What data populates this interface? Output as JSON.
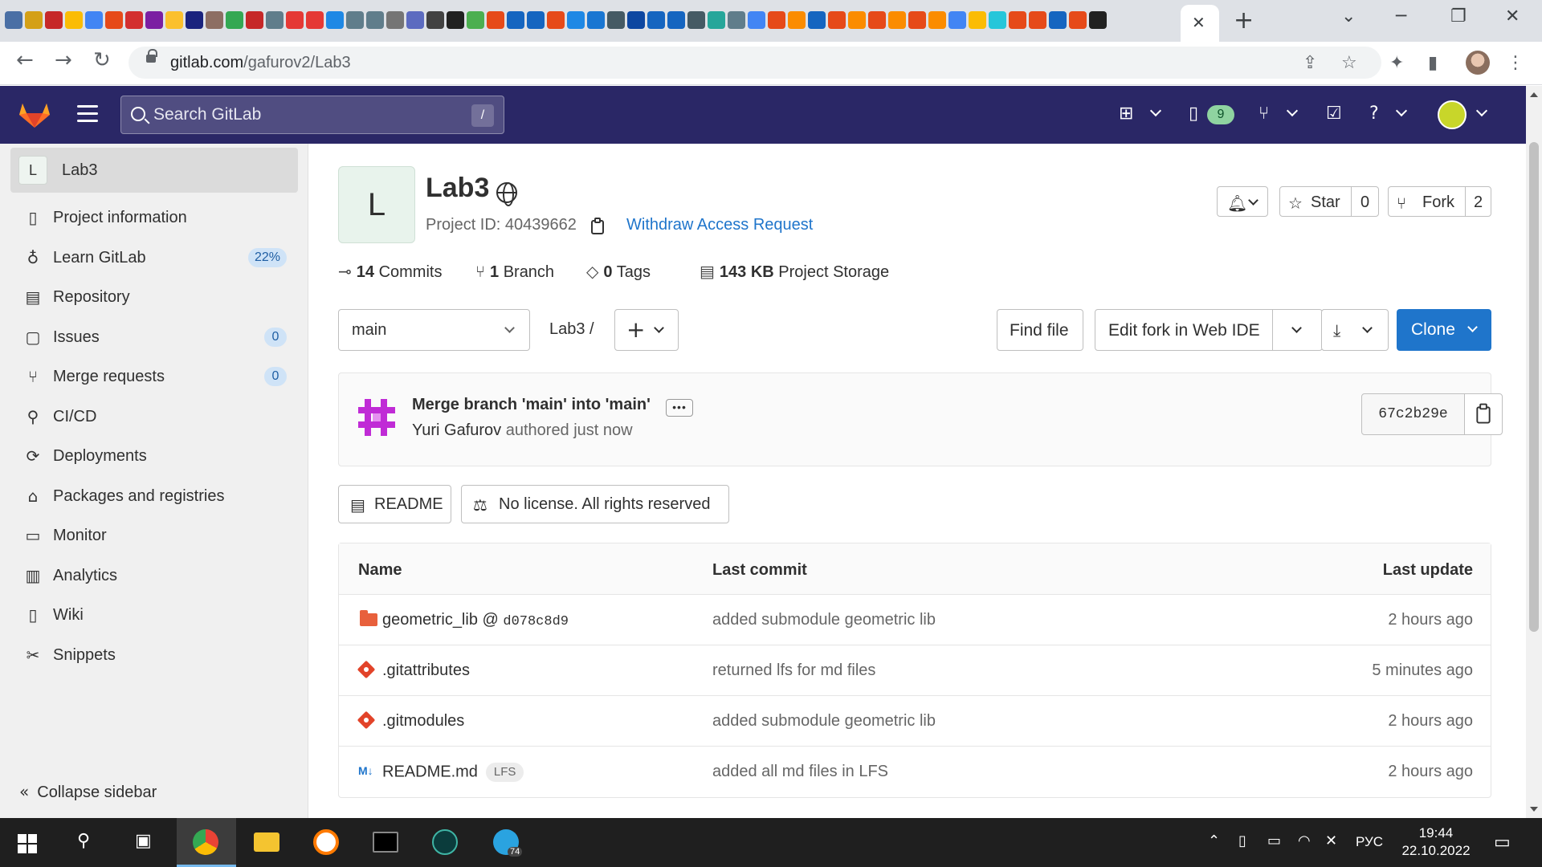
{
  "browser": {
    "url_host": "gitlab.com",
    "url_path": "/gafurov2/Lab3",
    "tab_close": "✕",
    "new_tab": "+",
    "tab_icon_colors": [
      "#4a6fa5",
      "#d4a017",
      "#c62828",
      "#fbbc05",
      "#4285f4",
      "#e64a19",
      "#d32f2f",
      "#7b1fa2",
      "#fbc02d",
      "#1a237e",
      "#8d6e63",
      "#34a853",
      "#c62828",
      "#607d8b",
      "#e53935",
      "#e53935",
      "#1e88e5",
      "#607d8b",
      "#607d8b",
      "#757575",
      "#5c6bc0",
      "#424242",
      "#212121",
      "#4caf50",
      "#e64a19",
      "#1565c0",
      "#1565c0",
      "#e64a19",
      "#1e88e5",
      "#1976d2",
      "#455a64",
      "#0d47a1",
      "#1565c0",
      "#1565c0",
      "#455a64",
      "#26a69a",
      "#607d8b",
      "#4285f4",
      "#e64a19",
      "#fb8c00",
      "#1565c0",
      "#e64a19",
      "#fb8c00",
      "#e64a19",
      "#fb8c00",
      "#e64a19",
      "#fb8c00",
      "#4285f4",
      "#fbbc05",
      "#26c6da",
      "#e64a19",
      "#e64a19",
      "#1565c0",
      "#e64a19",
      "#212121"
    ]
  },
  "header": {
    "search_placeholder": "Search GitLab",
    "search_shortcut": "/",
    "mr_count": "9",
    "accent": "#2a2766"
  },
  "sidebar": {
    "project_initial": "L",
    "project_name": "Lab3",
    "items": [
      {
        "label": "Project information",
        "icon": "info-doc-icon",
        "glyph": "▯"
      },
      {
        "label": "Learn GitLab",
        "icon": "bulb-icon",
        "glyph": "♁",
        "badge": "22%"
      },
      {
        "label": "Repository",
        "icon": "doc-icon",
        "glyph": "▤"
      },
      {
        "label": "Issues",
        "icon": "issues-icon",
        "glyph": "▢",
        "badge": "0"
      },
      {
        "label": "Merge requests",
        "icon": "merge-request-icon",
        "glyph": "⑂",
        "badge": "0"
      },
      {
        "label": "CI/CD",
        "icon": "rocket-icon",
        "glyph": "⚲"
      },
      {
        "label": "Deployments",
        "icon": "deploy-icon",
        "glyph": "⟳"
      },
      {
        "label": "Packages and registries",
        "icon": "package-icon",
        "glyph": "⌂"
      },
      {
        "label": "Monitor",
        "icon": "monitor-icon",
        "glyph": "▭"
      },
      {
        "label": "Analytics",
        "icon": "analytics-icon",
        "glyph": "▥"
      },
      {
        "label": "Wiki",
        "icon": "book-icon",
        "glyph": "▯"
      },
      {
        "label": "Snippets",
        "icon": "scissors-icon",
        "glyph": "✂"
      }
    ],
    "collapse_label": "Collapse sidebar",
    "collapse_glyph": "«"
  },
  "project": {
    "initial": "L",
    "title": "Lab3",
    "id_label": "Project ID: 40439662",
    "withdraw_label": "Withdraw Access Request",
    "star_label": "Star",
    "star_count": "0",
    "fork_label": "Fork",
    "fork_count": "2",
    "stats": {
      "commits_num": "14",
      "commits_label": "Commits",
      "branch_num": "1",
      "branch_label": "Branch",
      "tags_num": "0",
      "tags_label": "Tags",
      "storage_num": "143 KB",
      "storage_label": "Project Storage"
    }
  },
  "repo_bar": {
    "branch": "main",
    "breadcrumb": "Lab3  /",
    "find_file": "Find file",
    "edit_ide": "Edit fork in Web IDE",
    "clone": "Clone"
  },
  "last_commit": {
    "message": "Merge branch 'main' into 'main'",
    "more": "•••",
    "author": "Yuri Gafurov",
    "authored_text": " authored just now",
    "sha": "67c2b29e"
  },
  "pills": {
    "readme": "README",
    "license": "No license. All rights reserved"
  },
  "files": {
    "headers": {
      "name": "Name",
      "last_commit": "Last commit",
      "last_update": "Last update"
    },
    "rows": [
      {
        "type": "submodule",
        "name": "geometric_lib",
        "at": " @ ",
        "sha": "d078c8d9",
        "commit": "added submodule geometric lib",
        "updated": "2 hours ago"
      },
      {
        "type": "git",
        "name": ".gitattributes",
        "commit": "returned lfs for md files",
        "updated": "5 minutes ago"
      },
      {
        "type": "git",
        "name": ".gitmodules",
        "commit": "added submodule geometric lib",
        "updated": "2 hours ago"
      },
      {
        "type": "markdown",
        "name": "README.md",
        "badge": "LFS",
        "commit": "added all md files in LFS",
        "updated": "2 hours ago",
        "icon_text": "M↓"
      }
    ]
  },
  "taskbar": {
    "lang": "РУС",
    "time": "19:44",
    "date": "22.10.2022",
    "telegram_badge": "74"
  }
}
